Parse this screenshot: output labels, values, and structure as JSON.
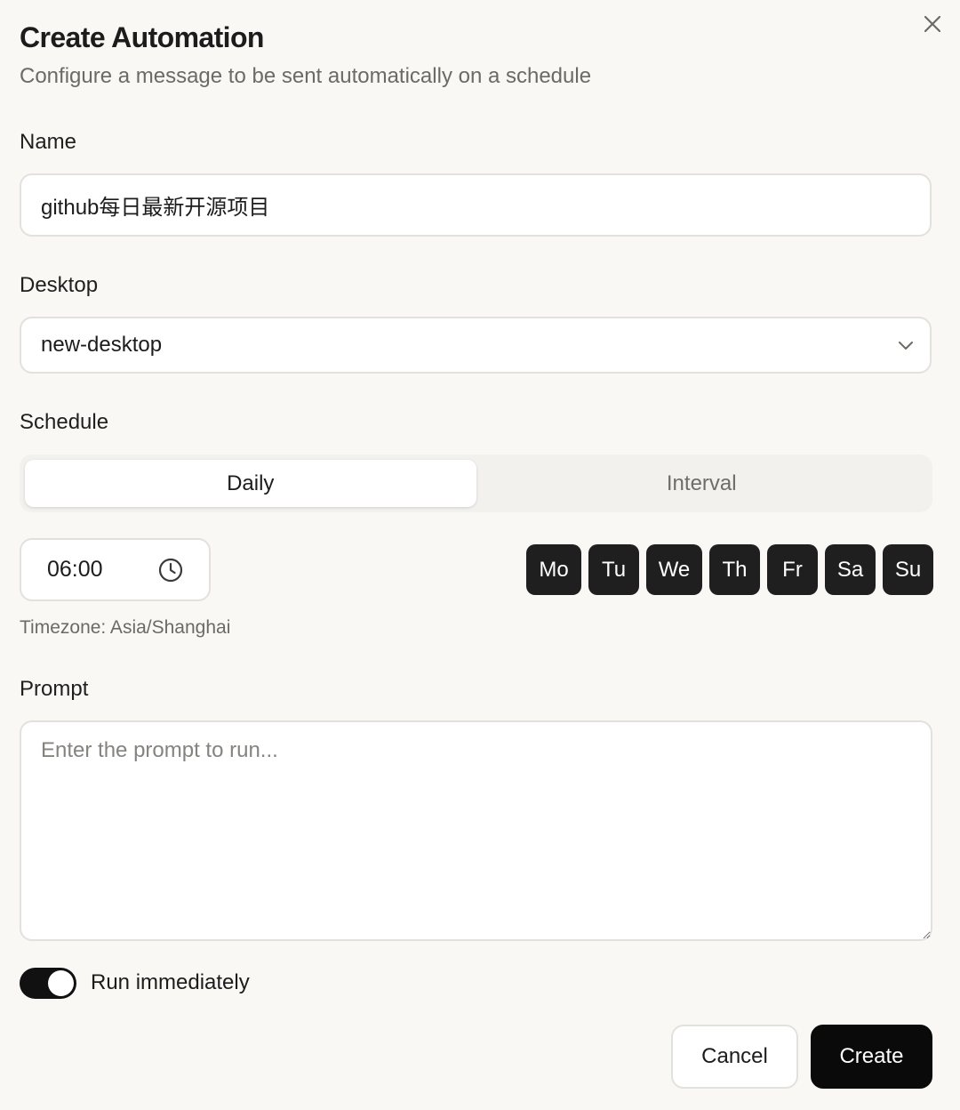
{
  "dialog": {
    "title": "Create Automation",
    "subtitle": "Configure a message to be sent automatically on a schedule",
    "close_icon": "close-icon"
  },
  "name": {
    "label": "Name",
    "value": "github每日最新开源项目"
  },
  "desktop": {
    "label": "Desktop",
    "selected": "new-desktop",
    "icon": "chevron-down-icon"
  },
  "schedule": {
    "label": "Schedule",
    "tabs": [
      {
        "label": "Daily",
        "active": true
      },
      {
        "label": "Interval",
        "active": false
      }
    ],
    "time": "06:00",
    "time_icon": "clock-icon",
    "days": [
      {
        "label": "Mo",
        "selected": true
      },
      {
        "label": "Tu",
        "selected": true
      },
      {
        "label": "We",
        "selected": true
      },
      {
        "label": "Th",
        "selected": true
      },
      {
        "label": "Fr",
        "selected": true
      },
      {
        "label": "Sa",
        "selected": true
      },
      {
        "label": "Su",
        "selected": true
      }
    ],
    "timezone": "Timezone: Asia/Shanghai"
  },
  "prompt": {
    "label": "Prompt",
    "value": "",
    "placeholder": "Enter the prompt to run..."
  },
  "run_immediately": {
    "label": "Run immediately",
    "enabled": true
  },
  "actions": {
    "cancel_label": "Cancel",
    "create_label": "Create"
  },
  "colors": {
    "background": "#f9f8f5",
    "primary": "#0a0a0a",
    "day_chip": "#1f1f1f",
    "border": "#e3e1dc"
  }
}
